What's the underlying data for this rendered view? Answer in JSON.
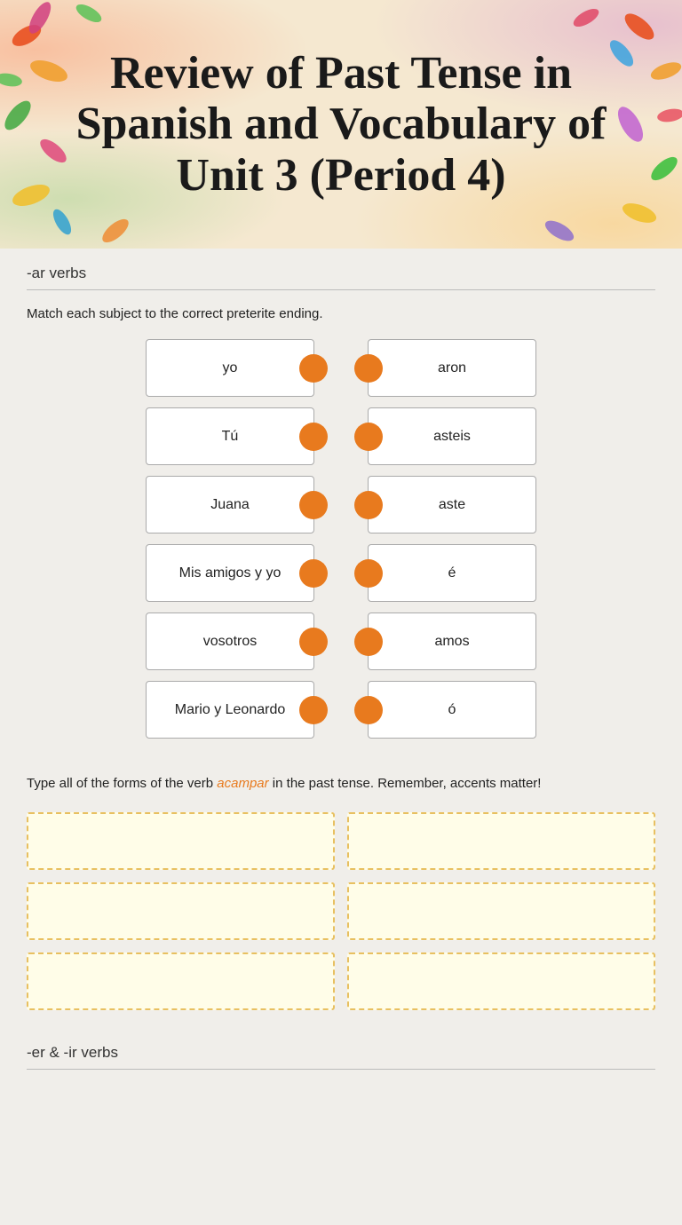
{
  "header": {
    "title": "Review of Past Tense in Spanish and Vocabulary of Unit 3 (Period 4)"
  },
  "sections": {
    "ar_verbs": {
      "label": "-ar verbs",
      "instruction": "Match each subject to the correct preterite ending.",
      "left_items": [
        "yo",
        "Tú",
        "Juana",
        "Mis amigos y yo",
        "vosotros",
        "Mario y Leonardo"
      ],
      "right_items": [
        "aron",
        "asteis",
        "aste",
        "é",
        "amos",
        "ó"
      ]
    },
    "verb_forms": {
      "instruction_start": "Type all of the forms of the verb ",
      "verb": "acampar",
      "instruction_end": " in the past tense. Remember, accents matter!",
      "inputs": [
        "",
        "",
        "",
        "",
        "",
        ""
      ]
    },
    "er_ir_verbs": {
      "label": "-er & -ir verbs"
    }
  }
}
